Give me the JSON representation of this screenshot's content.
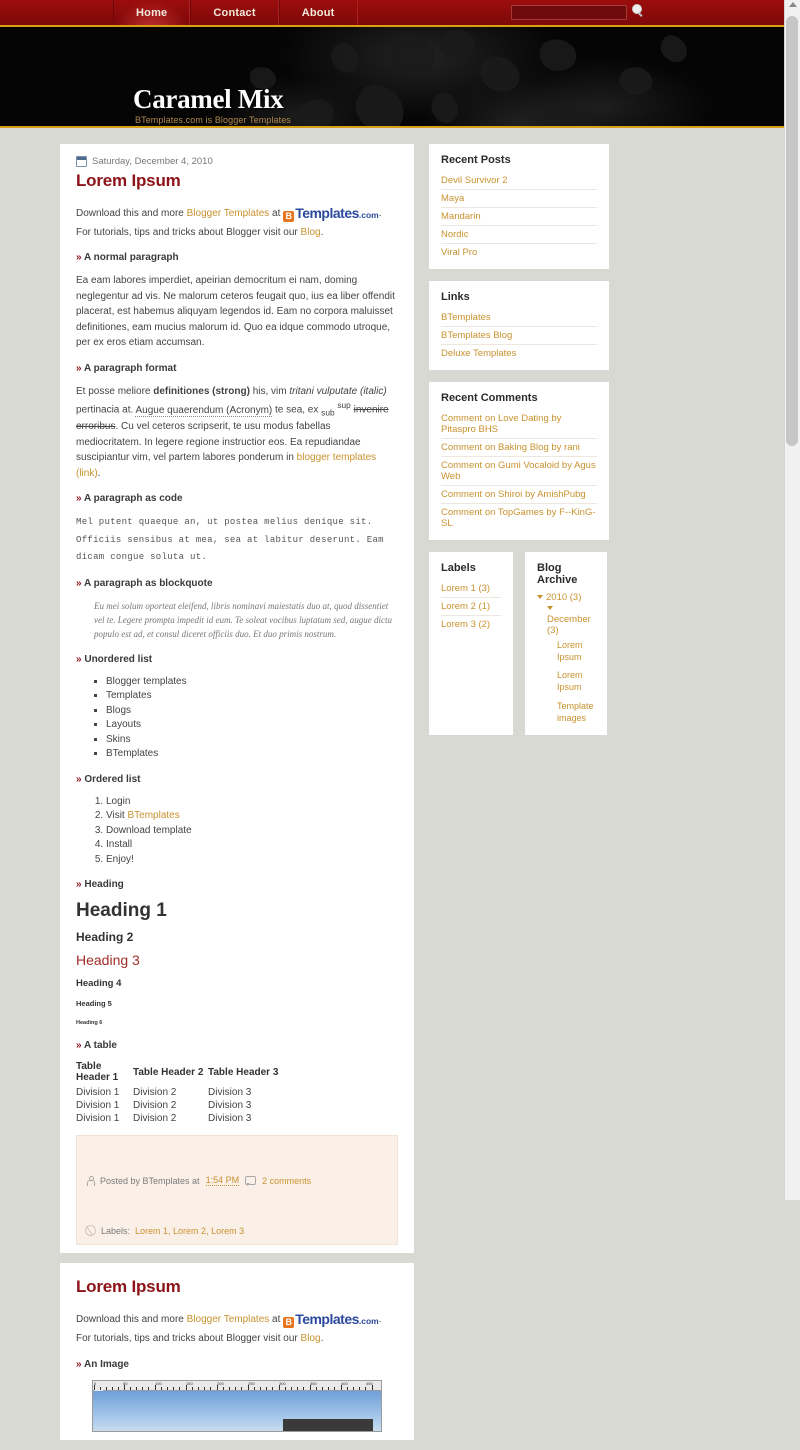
{
  "topnav": {
    "items": [
      {
        "label": "Home",
        "active": true
      },
      {
        "label": "Contact",
        "active": false
      },
      {
        "label": "About",
        "active": false
      }
    ],
    "search": {
      "value": "",
      "placeholder": "",
      "icon": "search-icon"
    }
  },
  "header": {
    "blog_title": "Caramel Mix",
    "blog_description": "BTemplates.com is Blogger Templates",
    "rss_icon": "rss-feed-icon"
  },
  "posts": [
    {
      "date": "Saturday, December 4, 2010",
      "title": "Lorem Ipsum",
      "intro": {
        "before_link": "Download this and more ",
        "link1": "Blogger Templates",
        "mid": " at ",
        "logo_b": "B",
        "logo_t": "Templates",
        "logo_dc": ".com",
        "after_logo": ". For tutorials, tips and tricks about Blogger visit our ",
        "link2": "Blog",
        "end": "."
      },
      "sections": {
        "normal_paragraph_heading": "A normal paragraph",
        "normal_paragraph": "Ea eam labores imperdiet, apeirian democritum ei nam, doming neglegentur ad vis. Ne malorum ceteros feugait quo, ius ea liber offendit placerat, est habemus aliquyam legendos id. Eam no corpora maluisset definitiones, eam mucius malorum id. Quo ea idque commodo utroque, per ex eros etiam accumsan.",
        "format_heading": "A paragraph format",
        "format_p1": "Et posse meliore ",
        "format_strong": "definitiones (strong)",
        "format_p2": " his, vim ",
        "format_italic": "tritani vulputate (italic)",
        "format_p3": " pertinacia at. ",
        "format_acronym": "Augue quaerendum (Acronym)",
        "format_p4": " te sea, ex ",
        "format_sub": "sub",
        "format_sup": "sup",
        "format_strike": "invenire erroribus",
        "format_p5": ". Cu vel ceteros scripserit, te usu modus fabellas mediocritatem. In legere regione instructior eos. Ea repudiandae suscipiantur vim, vel partem labores ponderum in ",
        "format_link": "blogger templates (link)",
        "format_p6": ".",
        "code_heading": "A paragraph as code",
        "code_text": "Mel putent quaeque an, ut postea melius denique sit. Officiis sensibus at mea, sea at labitur deserunt. Eam dicam congue soluta ut.",
        "blockquote_heading": "A paragraph as blockquote",
        "blockquote_text": "Eu mei solum oporteat eleifend, libris nominavi maiestatis duo at, quod dissentiet vel te. Legere prompta impedit id eum. Te soleat vocibus luptatum sed, augue dicta populo est ad, et consul diceret officiis duo. Et duo primis nostrum.",
        "ul_heading": "Unordered list",
        "ul_items": [
          "Blogger templates",
          "Templates",
          "Blogs",
          "Layouts",
          "Skins",
          "BTemplates"
        ],
        "ol_heading": "Ordered list",
        "ol_items": [
          {
            "text": "Login",
            "link": ""
          },
          {
            "text": "Visit ",
            "link": "BTemplates"
          },
          {
            "text": "Download template",
            "link": ""
          },
          {
            "text": "Install",
            "link": ""
          },
          {
            "text": "Enjoy!",
            "link": ""
          }
        ],
        "heading_heading": "Heading",
        "h1": "Heading 1",
        "h2": "Heading 2",
        "h3": "Heading 3",
        "h4": "Heading 4",
        "h5": "Heading 5",
        "h6": "Heading 6",
        "table_heading": "A table",
        "table": {
          "headers": [
            "Table Header 1",
            "Table Header 2",
            "Table Header 3"
          ],
          "rows": [
            [
              "Division 1",
              "Division 2",
              "Division 3"
            ],
            [
              "Division 1",
              "Division 2",
              "Division 3"
            ],
            [
              "Division 1",
              "Division 2",
              "Division 3"
            ]
          ]
        }
      },
      "footer": {
        "posted_by_prefix": "Posted by BTemplates at ",
        "time": "1:54 PM",
        "comments": "2 comments",
        "labels_prefix": "Labels:",
        "labels": "Lorem 1, Lorem 2, Lorem 3"
      }
    },
    {
      "title": "Lorem Ipsum",
      "image_heading": "An Image",
      "ruler_labels": [
        "0",
        "50",
        "100",
        "150",
        "200",
        "250",
        "300",
        "350",
        "400",
        "450"
      ]
    }
  ],
  "sidebar": {
    "recent_posts": {
      "title": "Recent Posts",
      "items": [
        "Devil Survivor 2",
        "Maya",
        "Mandarin",
        "Nordic",
        "Viral Pro"
      ]
    },
    "links": {
      "title": "Links",
      "items": [
        "BTemplates",
        "BTemplates Blog",
        "Deluxe Templates"
      ]
    },
    "recent_comments": {
      "title": "Recent Comments",
      "items": [
        "Comment on Love Dating by Pitaspro BHS",
        "Comment on Baking Blog by rani",
        "Comment on Gumi Vocaloid by Agus Web",
        "Comment on Shiroi by AmishPubg",
        "Comment on TopGames by F--KinG-SL"
      ]
    },
    "labels": {
      "title": "Labels",
      "items": [
        "Lorem 1 (3)",
        "Lorem 2 (1)",
        "Lorem 3 (2)"
      ]
    },
    "archive": {
      "title": "Blog Archive",
      "year": "2010 (3)",
      "month": "December (3)",
      "posts": [
        "Lorem Ipsum",
        "Lorem Ipsum",
        "Template images"
      ]
    }
  },
  "colors": {
    "nav_red": "#8e0b0b",
    "accent_gold": "#d9a017",
    "link_gold": "#c9922f",
    "title_maroon": "#8d1318",
    "page_bg": "#d9d9d4"
  }
}
